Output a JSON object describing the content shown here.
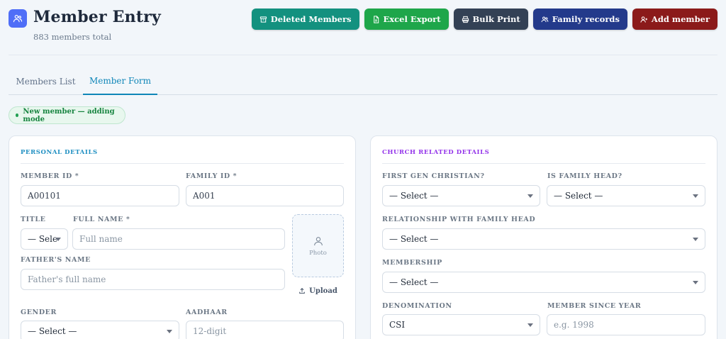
{
  "header": {
    "title": "Member Entry",
    "subtitle": "883 members total",
    "app_icon": "users-icon"
  },
  "actions": [
    {
      "label": "Deleted Members",
      "icon": "archive-icon",
      "color": "#13917f"
    },
    {
      "label": "Excel Export",
      "icon": "file-icon",
      "color": "#1ea64a"
    },
    {
      "label": "Bulk Print",
      "icon": "printer-icon",
      "color": "#334155"
    },
    {
      "label": "Family records",
      "icon": "users-icon",
      "color": "#233a8b"
    },
    {
      "label": "Add member",
      "icon": "user-plus-icon",
      "color": "#8b1a1a"
    }
  ],
  "tabs": [
    {
      "label": "Members List",
      "active": false
    },
    {
      "label": "Member Form",
      "active": true
    }
  ],
  "mode_badge": "New member — adding mode",
  "personal": {
    "title": "PERSONAL DETAILS",
    "title_color": "#1f8fc2",
    "member_id": {
      "label": "MEMBER ID *",
      "value": "A00101"
    },
    "family_id": {
      "label": "FAMILY ID *",
      "value": "A001"
    },
    "title_field": {
      "label": "TITLE",
      "value": "— Sele"
    },
    "full_name": {
      "label": "FULL NAME *",
      "placeholder": "Full name"
    },
    "father_name": {
      "label": "FATHER'S NAME",
      "placeholder": "Father's full name"
    },
    "photo": {
      "label": "Photo",
      "upload": "Upload"
    },
    "gender": {
      "label": "GENDER",
      "value": "— Select —"
    },
    "aadhaar": {
      "label": "AADHAAR",
      "placeholder": "12-digit"
    }
  },
  "church": {
    "title": "CHURCH RELATED DETAILS",
    "title_color": "#9333ea",
    "first_gen": {
      "label": "FIRST GEN CHRISTIAN?",
      "value": "— Select —"
    },
    "family_head": {
      "label": "IS FAMILY HEAD?",
      "value": "— Select —"
    },
    "relationship": {
      "label": "RELATIONSHIP WITH FAMILY HEAD",
      "value": "— Select —"
    },
    "membership": {
      "label": "MEMBERSHIP",
      "value": "— Select —"
    },
    "denomination": {
      "label": "DENOMINATION",
      "value": "CSI"
    },
    "member_since": {
      "label": "MEMBER SINCE YEAR",
      "placeholder": "e.g. 1998"
    }
  }
}
